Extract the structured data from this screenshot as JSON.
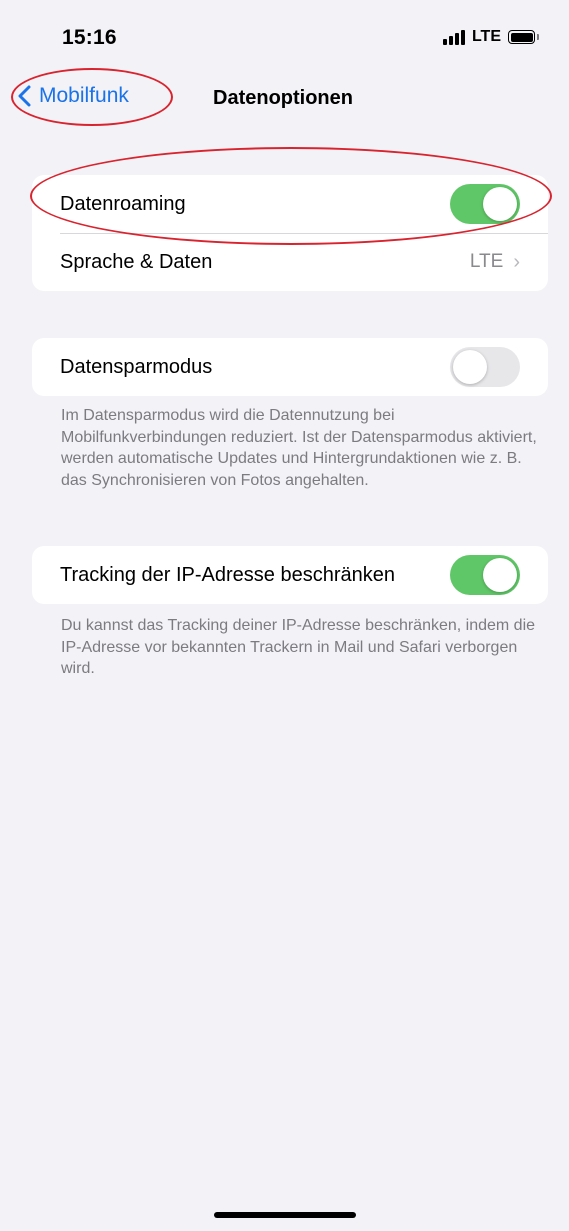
{
  "status_bar": {
    "time": "15:16",
    "network": "LTE"
  },
  "nav": {
    "back_label": "Mobilfunk",
    "title": "Datenoptionen"
  },
  "group1": {
    "roaming_label": "Datenroaming",
    "roaming_on": true,
    "voice_data_label": "Sprache & Daten",
    "voice_data_value": "LTE"
  },
  "group2": {
    "lowdata_label": "Datensparmodus",
    "lowdata_on": false,
    "lowdata_footnote": "Im Datensparmodus wird die Datennutzung bei Mobilfunkverbindungen reduziert. Ist der Datensparmodus aktiviert, werden automatische Updates und Hintergrundaktionen wie z. B. das Synchronisieren von Fotos angehalten."
  },
  "group3": {
    "iptracking_label": "Tracking der IP-Adresse beschränken",
    "iptracking_on": true,
    "iptracking_footnote": "Du kannst das Tracking deiner IP-Adresse beschränken, indem die IP-Adresse vor bekannten Trackern in Mail und Safari verborgen wird."
  },
  "colors": {
    "accent": "#1a73e8",
    "toggle_on": "#5fc767",
    "toggle_off": "#e7e7ea",
    "annotation": "#d9232e"
  }
}
